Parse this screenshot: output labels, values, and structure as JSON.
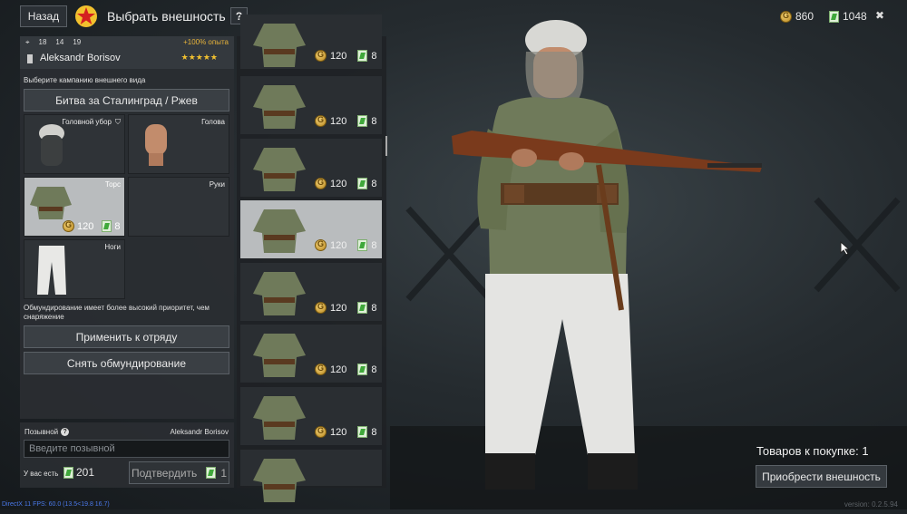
{
  "topbar": {
    "back_label": "Назад",
    "title": "Выбрать внешность",
    "help_label": "?",
    "gold": "860",
    "tickets": "1048",
    "close_label": "✖"
  },
  "soldier": {
    "stats": [
      "18",
      "14",
      "19"
    ],
    "bonus": "+100% опыта",
    "name": "Aleksandr Borisov",
    "stars": "★★★★★"
  },
  "campaign": {
    "label": "Выберите кампанию внешнего вида",
    "selected": "Битва за Сталинград / Ржев"
  },
  "slots": {
    "head_gear": "Головной убор",
    "head": "Голова",
    "torso": "Торс",
    "hands": "Руки",
    "legs": "Ноги",
    "torso_price_gold": "120",
    "torso_price_tickets": "8"
  },
  "note": "Обмундирование имеет более высокий приоритет, чем снаряжение",
  "actions": {
    "apply_squad": "Применить к отряду",
    "remove_uniform": "Снять обмундирование"
  },
  "callsign": {
    "label": "Позывной",
    "help": "?",
    "current": "Aleksandr Borisov",
    "placeholder": "Введите позывной",
    "have_label": "У вас есть",
    "have_value": "201",
    "confirm_label": "Подтвердить",
    "confirm_cost": "1"
  },
  "items": [
    {
      "gold": "120",
      "tickets": "8"
    },
    {
      "gold": "120",
      "tickets": "8"
    },
    {
      "gold": "120",
      "tickets": "8"
    },
    {
      "gold": "120",
      "tickets": "8"
    },
    {
      "gold": "120",
      "tickets": "8"
    },
    {
      "gold": "120",
      "tickets": "8"
    },
    {
      "gold": "120",
      "tickets": "8"
    },
    {
      "gold": "",
      "tickets": ""
    }
  ],
  "purchase": {
    "count_label": "Товаров к покупке: 1",
    "buy_label": "Приобрести внешность"
  },
  "debug": {
    "fps": "DirectX 11 FPS: 60.0 (13.5<19.8 16.7)",
    "version": "version: 0.2.5.94"
  }
}
